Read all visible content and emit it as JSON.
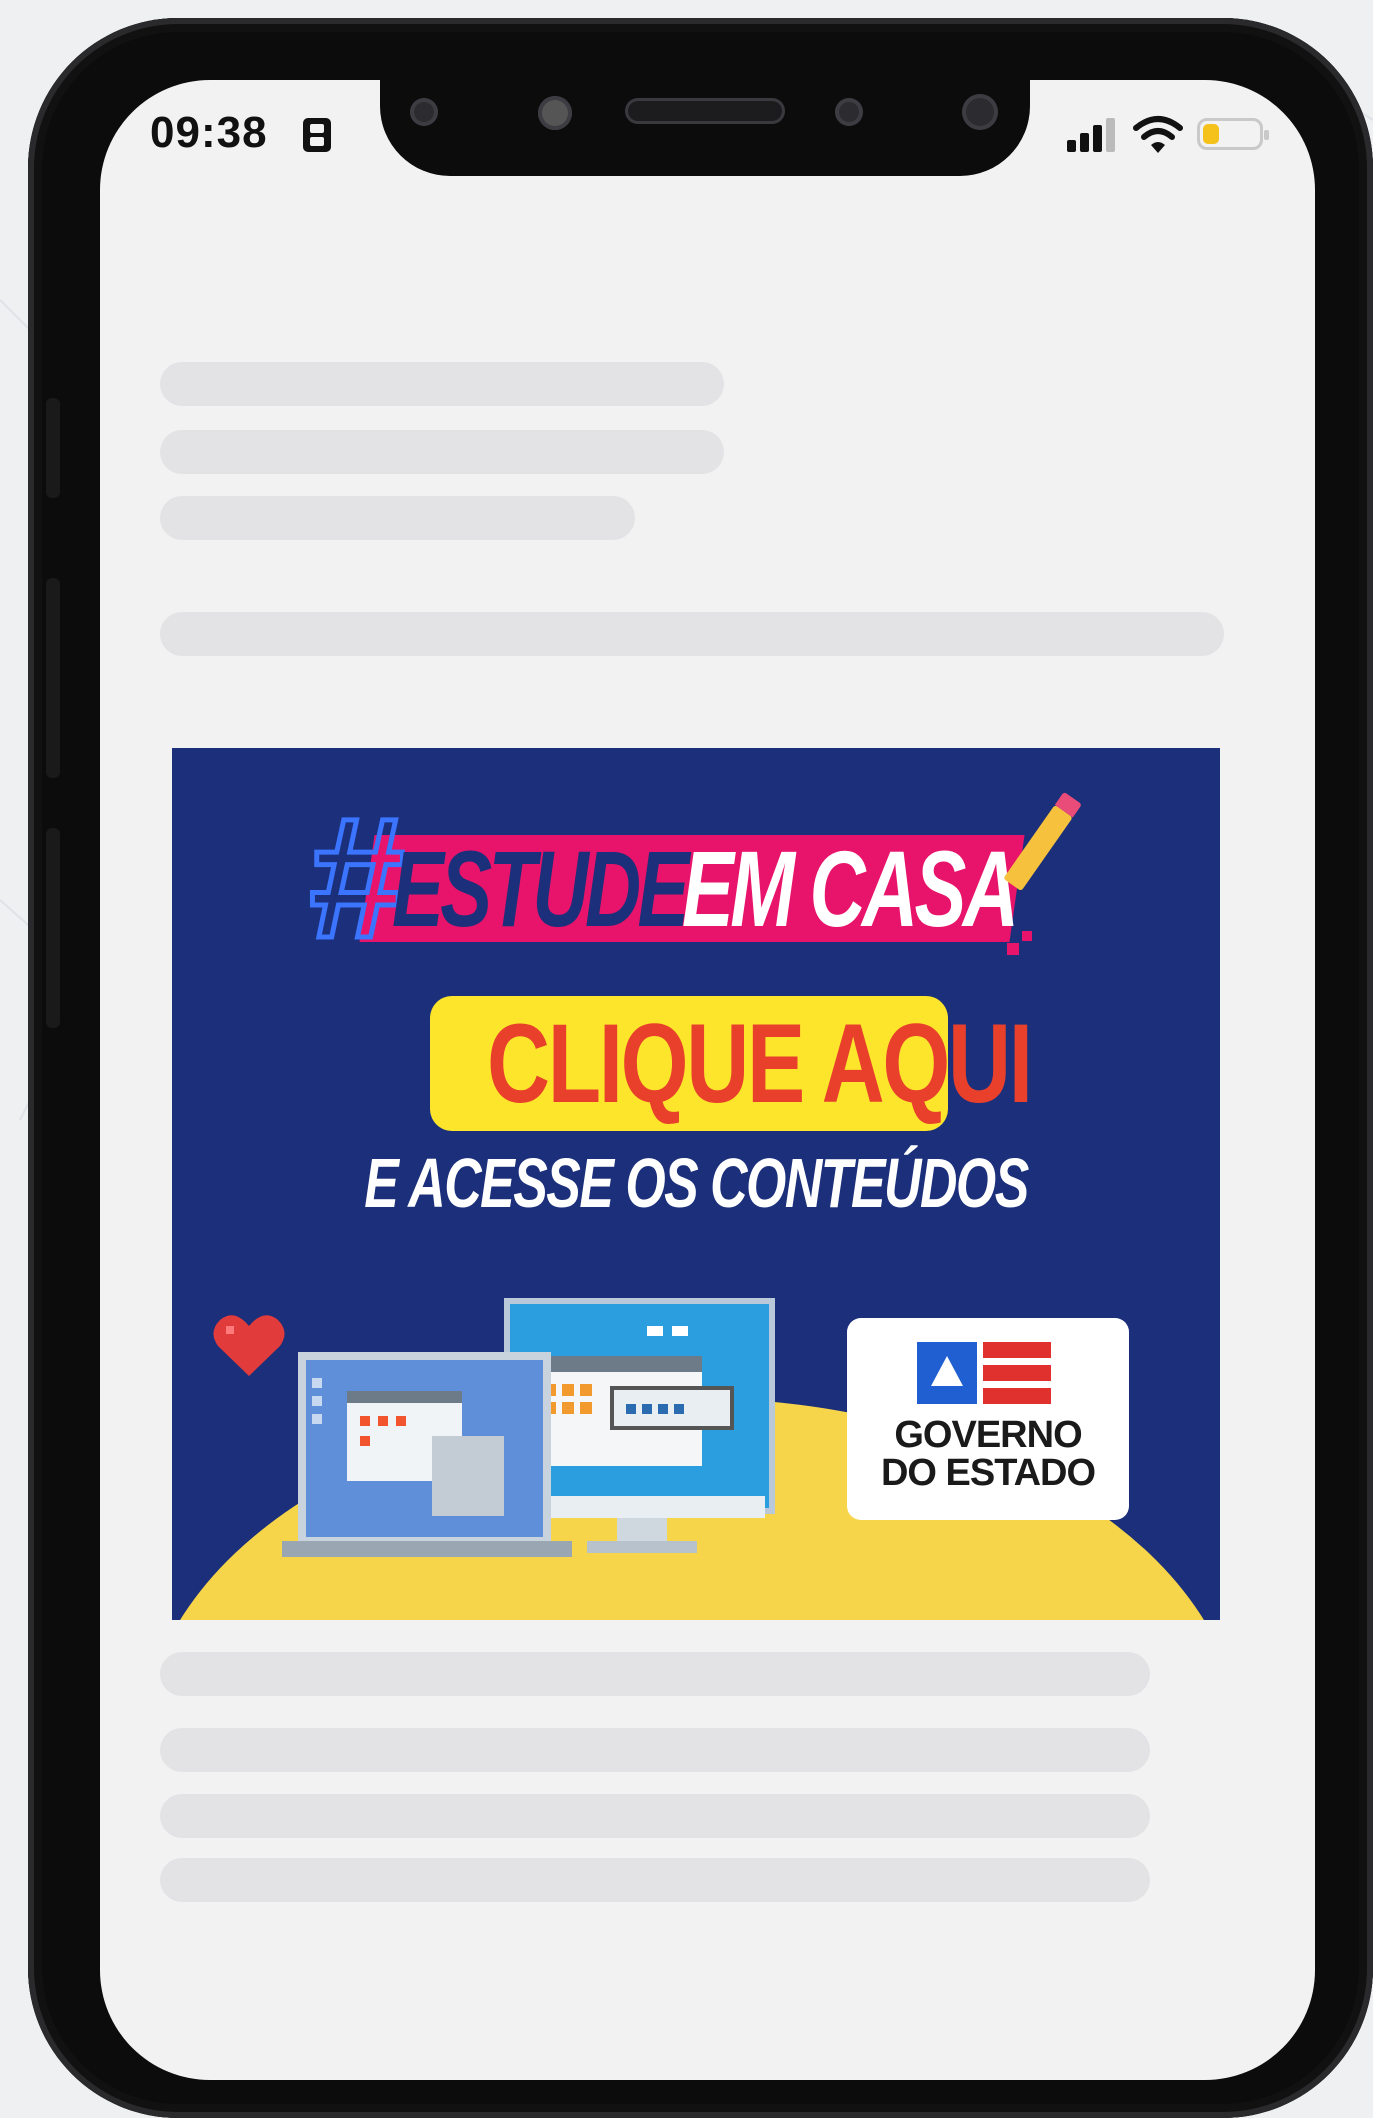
{
  "status_bar": {
    "time": "09:38",
    "icons": [
      "sim-card-icon",
      "signal-bars-icon",
      "wifi-icon",
      "battery-low-icon"
    ],
    "battery_level": 0.3
  },
  "banner": {
    "hashtag_symbol": "#",
    "hashtag_word1": "ESTUDE",
    "hashtag_word2": "EM CASA",
    "cta_label": "CLIQUE AQUI",
    "subtitle": "E ACESSE OS CONTEÚDOS",
    "logo_line1": "GOVERNO",
    "logo_line2": "DO ESTADO",
    "colors": {
      "background": "#1b2f7a",
      "pink": "#e8136a",
      "yellow": "#fde52c",
      "cta_text": "#e8402b",
      "hash_outline": "#3b74ff"
    },
    "icons": [
      "pencil-icon",
      "heart-icon",
      "laptop-icon",
      "monitor-icon",
      "bahia-flag-icon"
    ]
  }
}
